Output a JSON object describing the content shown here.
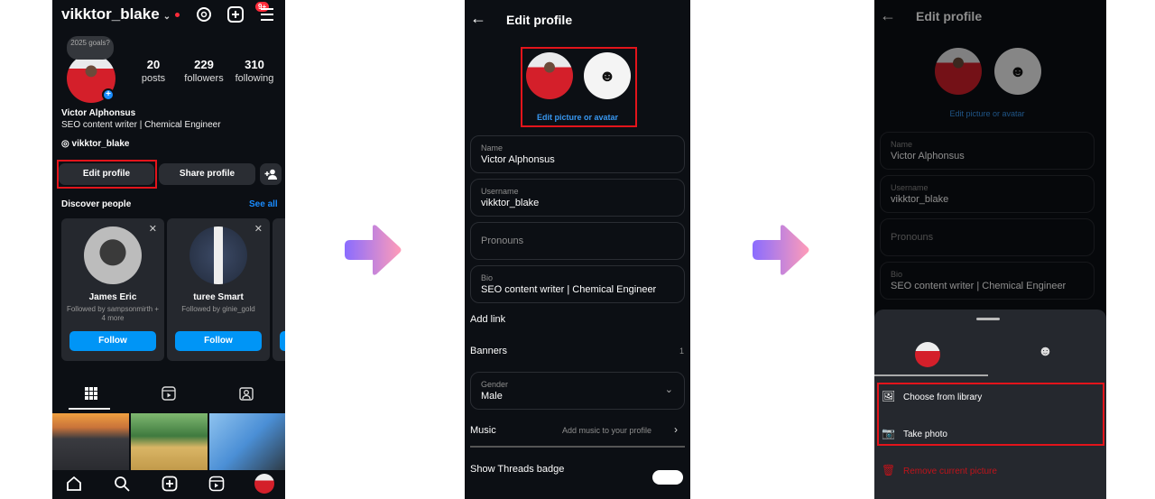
{
  "profile_screen": {
    "username": "vikktor_blake",
    "notification_badge": "9+",
    "story_bubble": "2025 goals?",
    "stats": [
      {
        "value": "20",
        "label": "posts"
      },
      {
        "value": "229",
        "label": "followers"
      },
      {
        "value": "310",
        "label": "following"
      }
    ],
    "full_name": "Victor Alphonsus",
    "bio": "SEO content writer | Chemical Engineer",
    "threads_handle": "vikktor_blake",
    "edit_profile_label": "Edit profile",
    "share_profile_label": "Share profile",
    "discover_title": "Discover people",
    "see_all_label": "See all",
    "suggestions": [
      {
        "name": "James Eric",
        "followed_by": "Followed by sampsonmirth + 4 more",
        "follow_label": "Follow"
      },
      {
        "name": "turee Smart",
        "followed_by": "Followed by ginie_gold",
        "follow_label": "Follow"
      }
    ],
    "icons": {
      "threads": "◎",
      "add": "⊞",
      "menu": "☰",
      "add_person": "👤+",
      "grid": "▦",
      "reels": "▶",
      "tagged": "👤",
      "home": "⌂",
      "search": "⌕",
      "create": "⊞",
      "reels_nav": "▶"
    }
  },
  "edit_profile_screen": {
    "title": "Edit profile",
    "back_icon": "←",
    "avatar_icon": "☻",
    "edit_picture_label": "Edit picture or avatar",
    "fields": {
      "name": {
        "label": "Name",
        "value": "Victor Alphonsus"
      },
      "username": {
        "label": "Username",
        "value": "vikktor_blake"
      },
      "pronouns": {
        "placeholder": "Pronouns"
      },
      "bio": {
        "label": "Bio",
        "value": "SEO content writer | Chemical Engineer"
      },
      "gender": {
        "label": "Gender",
        "value": "Male"
      }
    },
    "add_link_label": "Add link",
    "banners_label": "Banners",
    "banners_count": "1",
    "music_label": "Music",
    "music_hint": "Add music to your profile",
    "threads_badge_label": "Show Threads badge"
  },
  "picture_sheet": {
    "choose_library_label": "Choose from library",
    "take_photo_label": "Take photo",
    "remove_label": "Remove current picture",
    "remove_color": "#e3141b"
  },
  "colors": {
    "background": "#0c0f14",
    "accent": "#0095f6",
    "highlight_box": "#e3141b"
  }
}
